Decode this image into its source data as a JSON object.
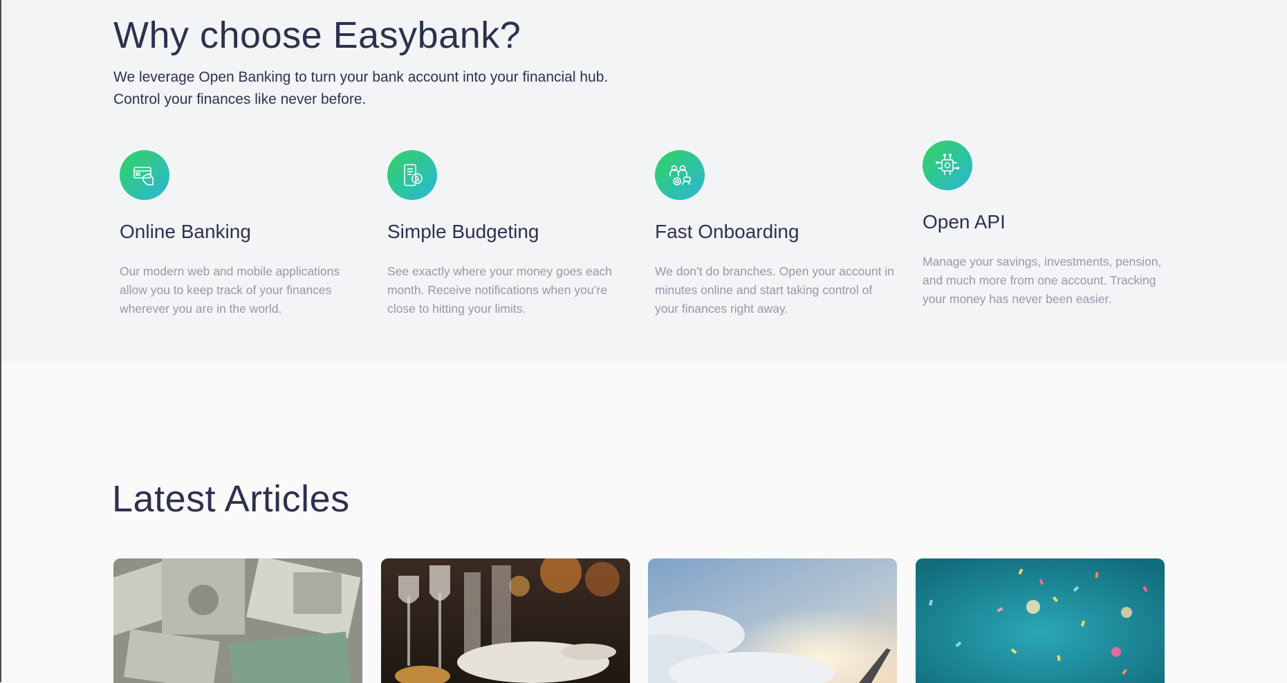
{
  "why": {
    "title": "Why choose Easybank?",
    "intro_line1": "We leverage Open Banking to turn your bank account into your financial hub.",
    "intro_line2": "Control your finances like never before.",
    "features": [
      {
        "icon": "online-banking-icon",
        "title": "Online Banking",
        "description": "Our modern web and mobile applications allow you to keep track of your finances wherever you are in the world."
      },
      {
        "icon": "simple-budgeting-icon",
        "title": "Simple Budgeting",
        "description": "See exactly where your money goes each month. Receive notifications when you’re close to hitting your limits."
      },
      {
        "icon": "fast-onboarding-icon",
        "title": "Fast Onboarding",
        "description": "We don’t do branches. Open your account in minutes online and start taking control of your finances right away."
      },
      {
        "icon": "open-api-icon",
        "title": "Open API",
        "description": "Manage your savings, investments, pension, and much more from one account. Tracking your money has never been easier."
      }
    ]
  },
  "articles": {
    "title": "Latest Articles",
    "cards": [
      {
        "image": "currency-image"
      },
      {
        "image": "restaurant-image"
      },
      {
        "image": "plane-image"
      },
      {
        "image": "confetti-image"
      }
    ]
  },
  "colors": {
    "dark_blue": "#2d314d",
    "grayish_blue": "#9698a6",
    "lime_green": "#33d35e",
    "bright_cyan": "#2ab6d9",
    "section_bg": "#f3f4f6",
    "page_bg": "#fafafa"
  }
}
